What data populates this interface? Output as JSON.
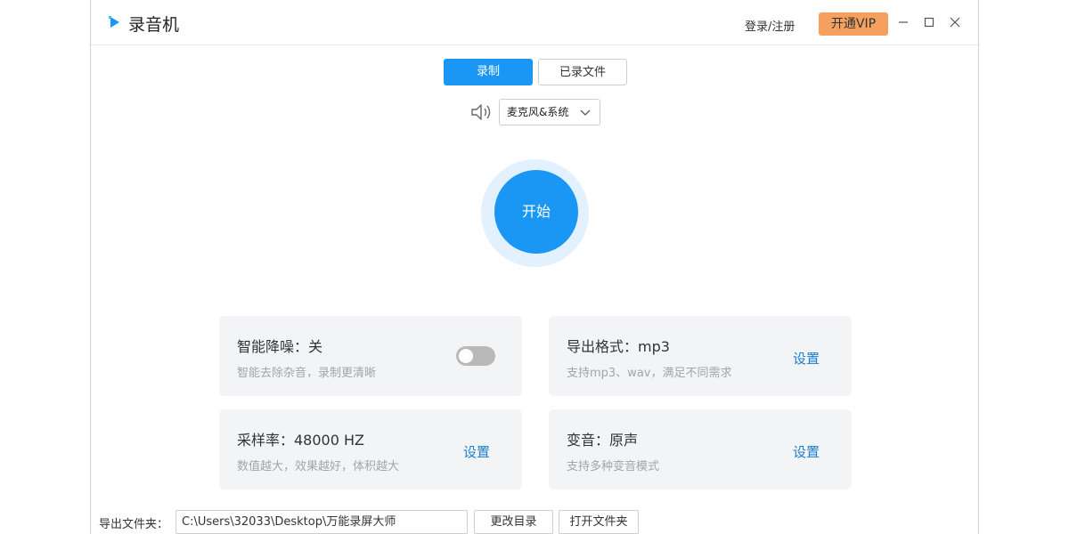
{
  "app": {
    "title": "录音机",
    "login_label": "登录/注册",
    "vip_label": "开通VIP"
  },
  "tabs": {
    "record_label": "录制",
    "files_label": "已录文件"
  },
  "source": {
    "selected": "麦克风&系统"
  },
  "start_label": "开始",
  "cards": {
    "noise": {
      "title": "智能降噪：关",
      "desc": "智能去除杂音，录制更清晰",
      "enabled": false
    },
    "format": {
      "title": "导出格式：mp3",
      "desc": "支持mp3、wav，满足不同需求",
      "link": "设置"
    },
    "sample": {
      "title": "采样率：48000 HZ",
      "desc": "数值越大，效果越好，体积越大",
      "link": "设置"
    },
    "voice": {
      "title": "变音：原声",
      "desc": "支持多种变音模式",
      "link": "设置"
    }
  },
  "footer": {
    "label": "导出文件夹：",
    "path": "C:\\Users\\32033\\Desktop\\万能录屏大师",
    "change_label": "更改目录",
    "open_label": "打开文件夹"
  },
  "colors": {
    "accent": "#1a97f5",
    "vip": "#f5a05e",
    "card_bg": "#f3f4f6",
    "link": "#1a7fcf"
  }
}
